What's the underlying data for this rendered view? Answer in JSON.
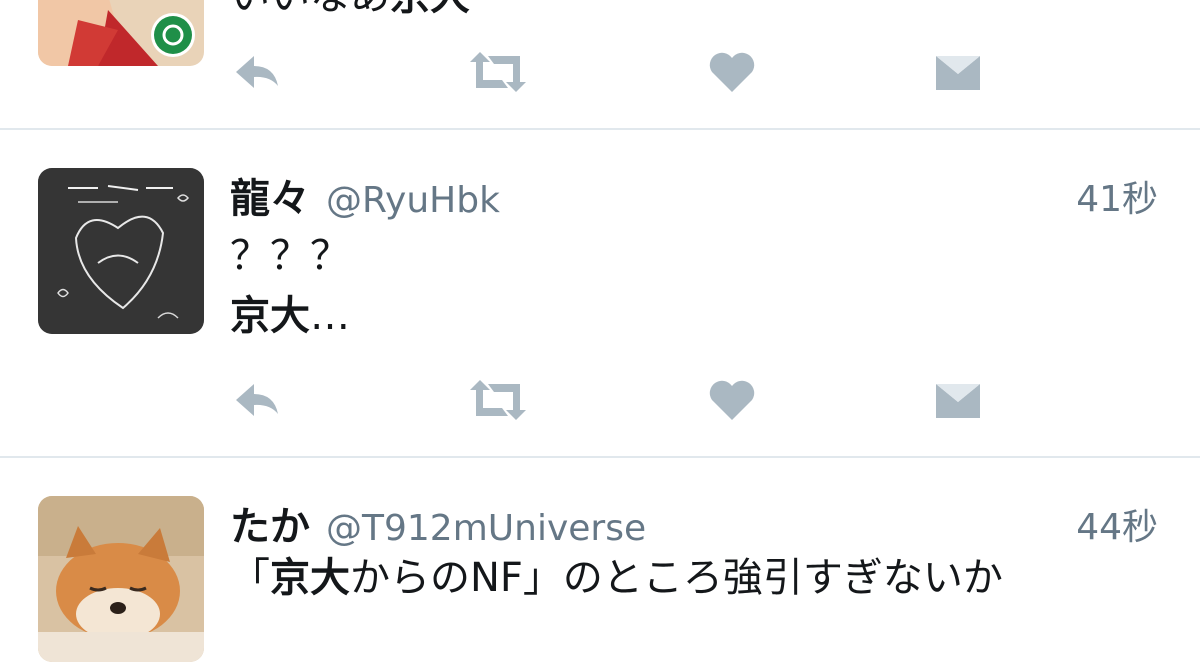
{
  "timeline": {
    "tweets": [
      {
        "name": "",
        "handle": "",
        "time": "",
        "lines": [
          [
            {
              "text": "いいなあ",
              "bold": false
            },
            {
              "text": "京大",
              "bold": true
            }
          ]
        ]
      },
      {
        "name": "龍々",
        "handle": "@RyuHbk",
        "time": "41秒",
        "lines": [
          [
            {
              "text": "？？？",
              "bold": false
            }
          ],
          [
            {
              "text": "京大",
              "bold": true
            },
            {
              "text": "…",
              "bold": false
            }
          ]
        ]
      },
      {
        "name": "たか",
        "handle": "@T912mUniverse",
        "time": "44秒",
        "lines": [
          [
            {
              "text": "「",
              "bold": false
            },
            {
              "text": "京大",
              "bold": true
            },
            {
              "text": "からのNF」のところ強引すぎないか",
              "bold": false
            }
          ]
        ]
      }
    ]
  },
  "icons": {
    "reply": "reply-icon",
    "retweet": "retweet-icon",
    "like": "heart-icon",
    "dm": "direct-message-icon"
  },
  "colors": {
    "action_icon": "#aab8c2",
    "divider": "#e1e8ed",
    "secondary_text": "#657786",
    "primary_text": "#14171a"
  }
}
